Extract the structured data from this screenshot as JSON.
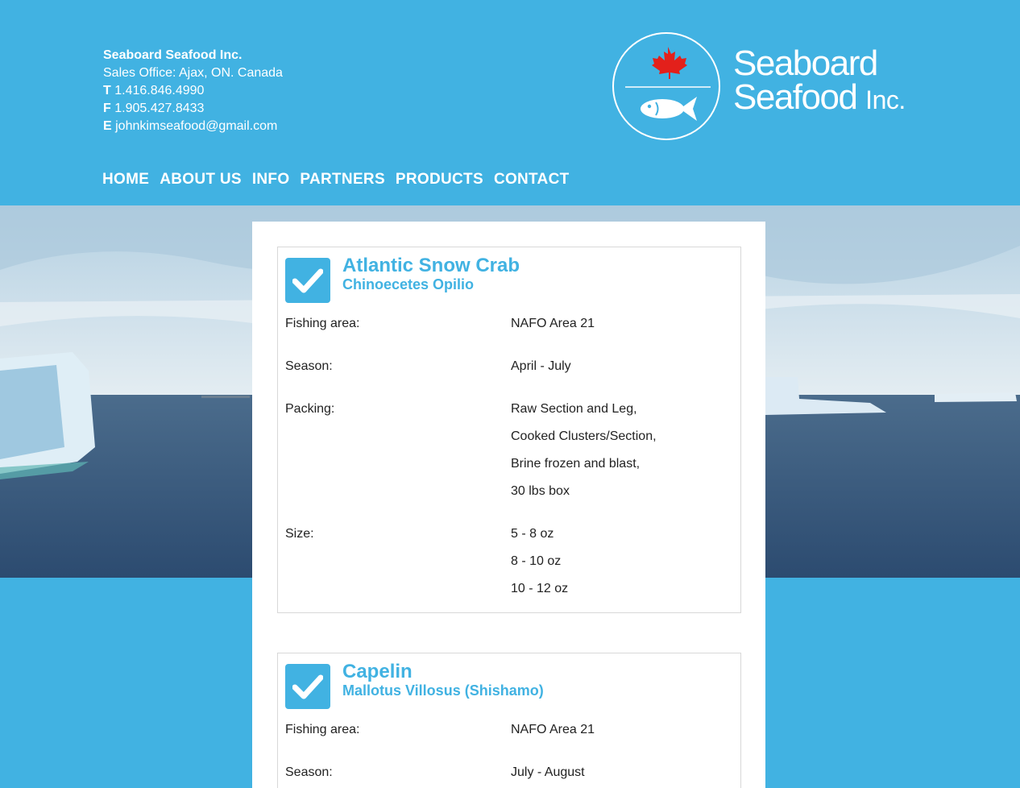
{
  "contact": {
    "company": "Seaboard Seafood Inc.",
    "office": "Sales Office: Ajax, ON. Canada",
    "phone_label": "T",
    "phone": " 1.416.846.4990",
    "fax_label": "F",
    "fax": " 1.905.427.8433",
    "email_label": "E",
    "email": " johnkimseafood@gmail.com"
  },
  "logo": {
    "line1": "Seaboard",
    "line2": "Seafood",
    "inc": "Inc."
  },
  "nav": [
    "HOME",
    "ABOUT US",
    "INFO",
    "PARTNERS",
    "PRODUCTS",
    "CONTACT"
  ],
  "products": [
    {
      "name": "Atlantic Snow Crab",
      "latin": "Chinoecetes Opilio",
      "specs": [
        {
          "label": "Fishing area:",
          "values": [
            "NAFO Area 21"
          ]
        },
        {
          "label": "Season:",
          "values": [
            "April - July"
          ]
        },
        {
          "label": "Packing:",
          "values": [
            "Raw Section and Leg,",
            "Cooked Clusters/Section,",
            "Brine frozen and blast,",
            "30 lbs box"
          ]
        },
        {
          "label": "Size:",
          "values": [
            "5 - 8 oz",
            "8 - 10 oz",
            "10 - 12 oz"
          ]
        }
      ]
    },
    {
      "name": "Capelin",
      "latin": "Mallotus Villosus (Shishamo)",
      "specs": [
        {
          "label": "Fishing area:",
          "values": [
            "NAFO Area 21"
          ]
        },
        {
          "label": "Season:",
          "values": [
            "July - August"
          ]
        }
      ]
    }
  ],
  "colors": {
    "brand": "#41b2e2",
    "white": "#ffffff",
    "maple": "#e3201b"
  }
}
